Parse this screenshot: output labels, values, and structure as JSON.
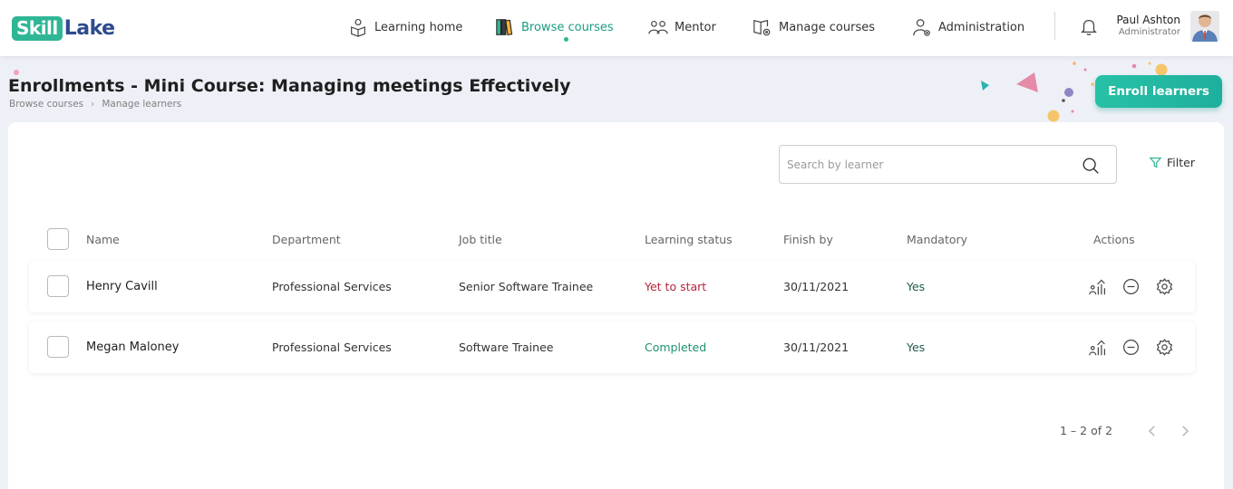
{
  "brand": {
    "logo_part1": "Skill",
    "logo_part2": "Lake"
  },
  "nav": {
    "items": [
      {
        "label": "Learning home",
        "icon": "learning-home-icon"
      },
      {
        "label": "Browse courses",
        "icon": "books-icon",
        "active": true
      },
      {
        "label": "Mentor",
        "icon": "mentor-icon"
      },
      {
        "label": "Manage courses",
        "icon": "manage-courses-icon"
      },
      {
        "label": "Administration",
        "icon": "admin-user-icon"
      }
    ],
    "user": {
      "name": "Paul Ashton",
      "role": "Administrator"
    }
  },
  "page": {
    "title": "Enrollments - Mini Course: Managing meetings Effectively",
    "breadcrumb": [
      "Browse courses",
      "Manage learners"
    ],
    "enroll_button": "Enroll learners"
  },
  "toolbar": {
    "search_placeholder": "Search by learner",
    "filter_label": "Filter"
  },
  "table": {
    "columns": [
      "Name",
      "Department",
      "Job title",
      "Learning status",
      "Finish by",
      "Mandatory",
      "Actions"
    ],
    "rows": [
      {
        "name": "Henry Cavill",
        "department": "Professional Services",
        "job_title": "Senior Software Trainee",
        "status": "Yet to start",
        "finish_by": "30/11/2021",
        "mandatory": "Yes"
      },
      {
        "name": "Megan Maloney",
        "department": "Professional Services",
        "job_title": "Software Trainee",
        "status": "Completed",
        "finish_by": "30/11/2021",
        "mandatory": "Yes"
      }
    ]
  },
  "pagination": {
    "text": "1 – 2 of 2"
  },
  "colors": {
    "brand_green": "#2fb795",
    "brand_blue": "#2e4a8f",
    "status_pending": "#b3263a",
    "status_done": "#1f9170",
    "mandatory": "#1e5a4c"
  }
}
